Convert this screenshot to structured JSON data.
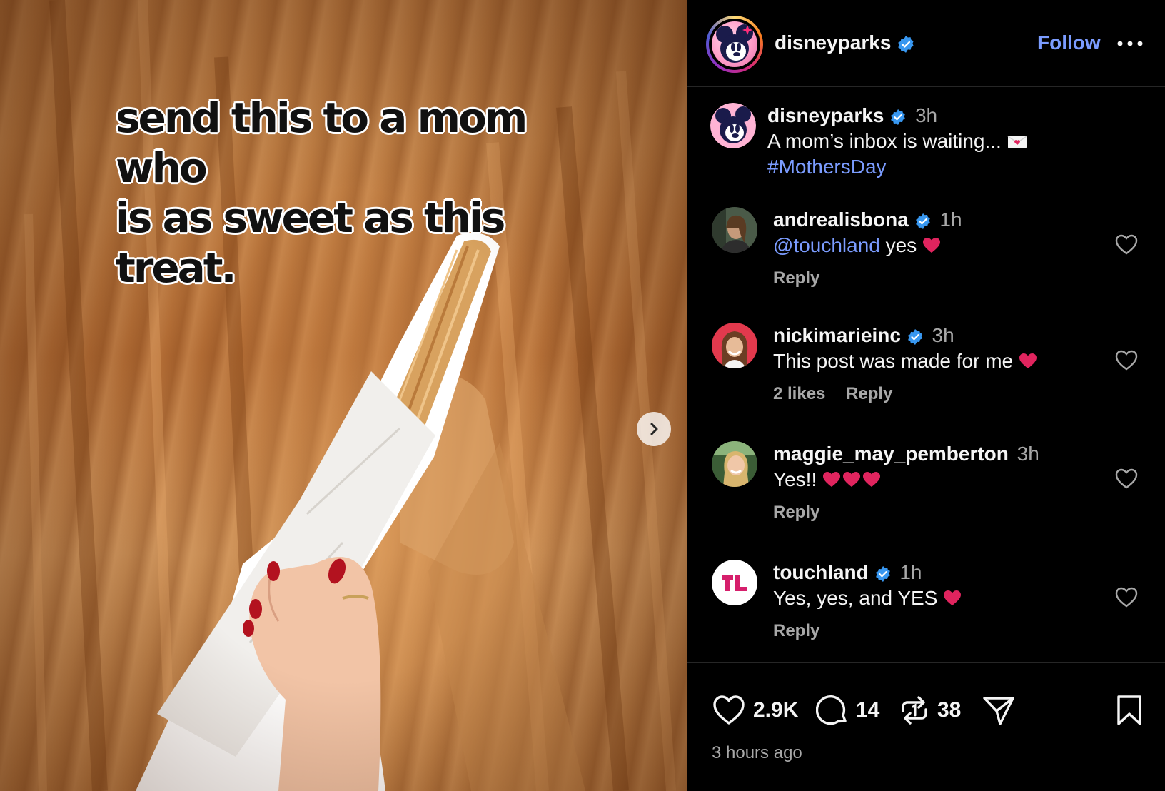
{
  "post": {
    "image_caption_line1": "send this to a mom who",
    "image_caption_line2": "is as sweet as this treat."
  },
  "header": {
    "username": "disneyparks",
    "follow_label": "Follow"
  },
  "caption": {
    "username": "disneyparks",
    "time": "3h",
    "text": "A mom’s inbox is waiting...",
    "hashtag": "#MothersDay"
  },
  "comments": [
    {
      "username": "andrealisbona",
      "time": "1h",
      "mention": "@touchland",
      "text": " yes",
      "meta": [
        "Reply"
      ]
    },
    {
      "username": "nickimarieinc",
      "time": "3h",
      "mention": "",
      "text": "This post was made for me",
      "meta": [
        "2 likes",
        "Reply"
      ]
    },
    {
      "username": "maggie_may_pemberton",
      "time": "3h",
      "mention": "",
      "text": "Yes!!",
      "meta": [
        "Reply"
      ]
    },
    {
      "username": "touchland",
      "time": "1h",
      "mention": "",
      "text": "Yes, yes, and YES",
      "meta": [
        "Reply"
      ]
    }
  ],
  "stats": {
    "likes": "2.9K",
    "comments": "14",
    "reposts": "38",
    "posted_ago": "3 hours ago"
  },
  "colors": {
    "link": "#7b9cff",
    "verified": "#3897f0",
    "muted": "#a8a8a8",
    "heart": "#e0245e"
  },
  "icons": [
    "verified-badge-icon",
    "more-icon",
    "heart-outline-icon",
    "comment-icon",
    "repost-icon",
    "share-icon",
    "bookmark-icon",
    "chevron-right-icon",
    "envelope-heart-icon"
  ]
}
